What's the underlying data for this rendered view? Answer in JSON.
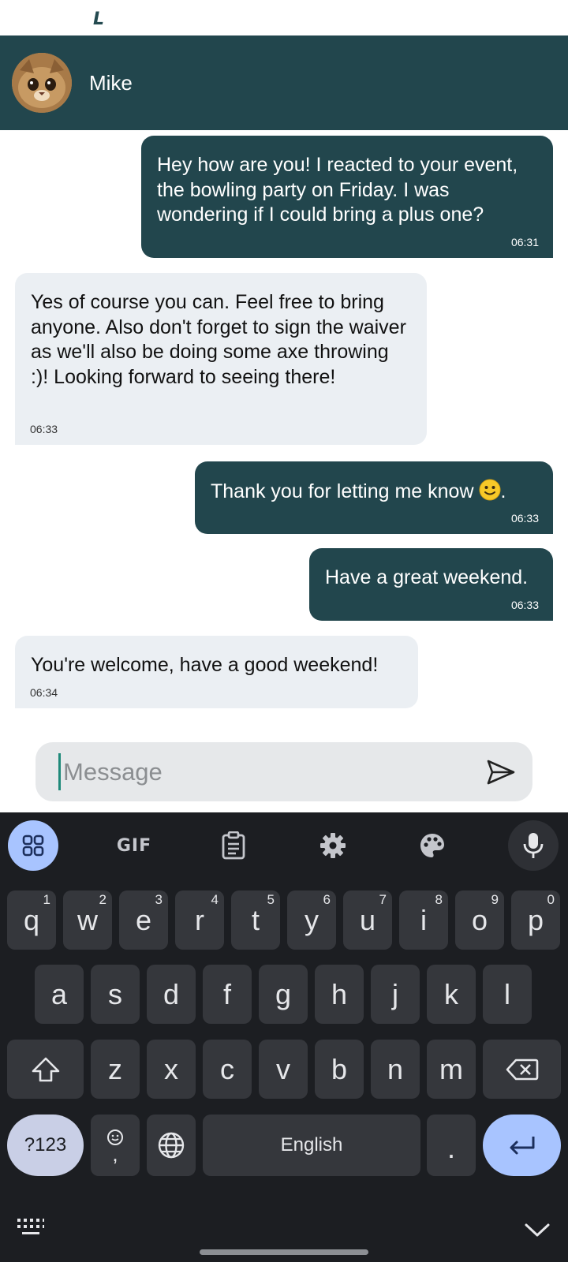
{
  "status_bar": {
    "indicator": "L"
  },
  "header": {
    "contact_name": "Mike",
    "avatar_icon": "cat-avatar"
  },
  "messages": [
    {
      "direction": "out",
      "text": "Hey how are you! I reacted to your event, the bowling party on Friday. I was wondering if I could bring a plus one?",
      "time": "06:31"
    },
    {
      "direction": "in",
      "text": "Yes of course you can. Feel free to bring anyone. Also don't forget to sign the waiver as we'll also be doing some axe throwing :)! Looking forward to seeing there!",
      "time": "06:33"
    },
    {
      "direction": "out",
      "text": "Thank you for letting me know",
      "emoji": "slightly-smiling-face-icon",
      "trailing": ".",
      "time": "06:33"
    },
    {
      "direction": "out",
      "text": "Have a great weekend.",
      "time": "06:33"
    },
    {
      "direction": "in",
      "text": "You're welcome, have a good weekend!",
      "time": "06:34"
    }
  ],
  "input": {
    "placeholder": "Message",
    "value": "",
    "send_icon": "send-icon"
  },
  "keyboard": {
    "toolbar": {
      "gif_label": "GIF"
    },
    "row1": [
      {
        "key": "q",
        "hint": "1"
      },
      {
        "key": "w",
        "hint": "2"
      },
      {
        "key": "e",
        "hint": "3"
      },
      {
        "key": "r",
        "hint": "4"
      },
      {
        "key": "t",
        "hint": "5"
      },
      {
        "key": "y",
        "hint": "6"
      },
      {
        "key": "u",
        "hint": "7"
      },
      {
        "key": "i",
        "hint": "8"
      },
      {
        "key": "o",
        "hint": "9"
      },
      {
        "key": "p",
        "hint": "0"
      }
    ],
    "row2": [
      "a",
      "s",
      "d",
      "f",
      "g",
      "h",
      "j",
      "k",
      "l"
    ],
    "row3": [
      "z",
      "x",
      "c",
      "v",
      "b",
      "n",
      "m"
    ],
    "symbols_label": "?123",
    "comma_label": ",",
    "space_label": "English",
    "period_label": "."
  },
  "colors": {
    "header": "#22464d",
    "outgoing_bubble": "#22464d",
    "incoming_bubble": "#ebeff3",
    "keyboard_bg": "#1c1e22",
    "key_bg": "#35373c",
    "accent": "#a8c4ff"
  }
}
